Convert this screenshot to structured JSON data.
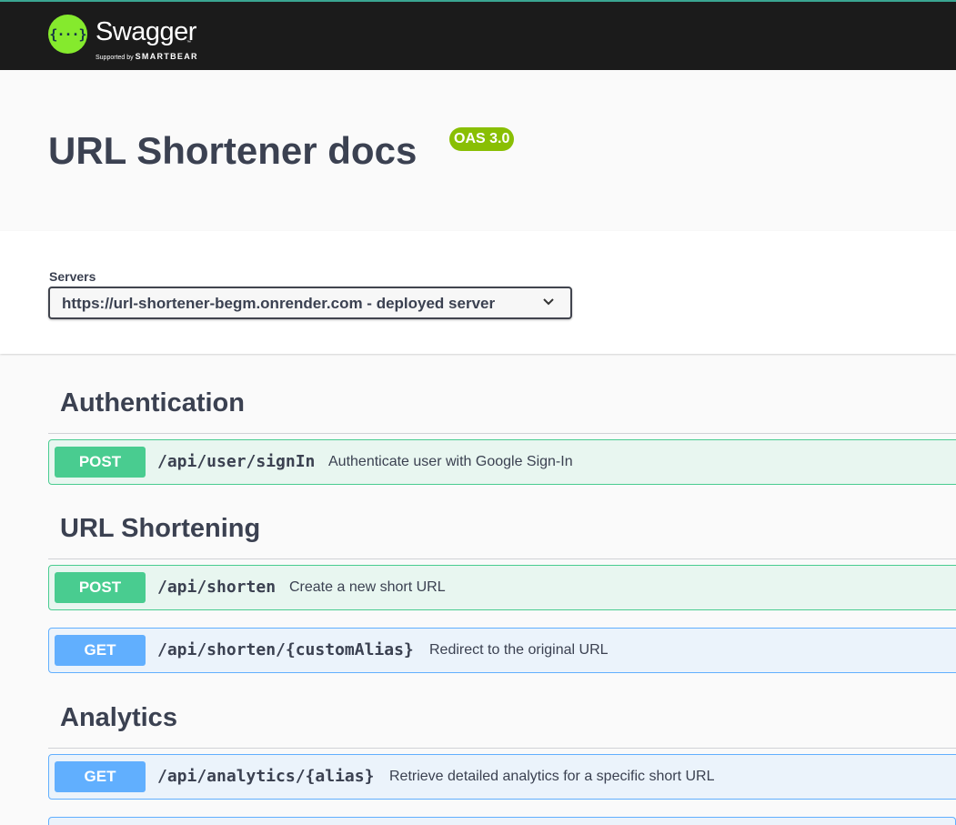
{
  "topbar": {
    "logo_mark": "{···}",
    "logo_text": "Swagger",
    "logo_tm": "™",
    "logo_supported_by": "Supported by",
    "logo_brand": "SMARTBEAR"
  },
  "info": {
    "title": "URL Shortener docs",
    "version_badge": "OAS 3.0"
  },
  "servers": {
    "label": "Servers",
    "selected": "https://url-shortener-begm.onrender.com - deployed server"
  },
  "tags": [
    {
      "name": "Authentication",
      "operations": [
        {
          "method": "POST",
          "path": "/api/user/signIn",
          "summary": "Authenticate user with Google Sign-In"
        }
      ]
    },
    {
      "name": "URL Shortening",
      "operations": [
        {
          "method": "POST",
          "path": "/api/shorten",
          "summary": "Create a new short URL"
        },
        {
          "method": "GET",
          "path": "/api/shorten/{customAlias}",
          "summary": "Redirect to the original URL"
        }
      ]
    },
    {
      "name": "Analytics",
      "operations": [
        {
          "method": "GET",
          "path": "/api/analytics/{alias}",
          "summary": "Retrieve detailed analytics for a specific short URL"
        }
      ]
    }
  ],
  "colors": {
    "topbar_bg": "#1b1b1b",
    "logo_green": "#85ea2d",
    "badge_green": "#89bf04",
    "post": "#49cc90",
    "get": "#61affe",
    "text": "#3b4151"
  },
  "icons": {
    "servers_dropdown": "chevron-down-icon"
  }
}
